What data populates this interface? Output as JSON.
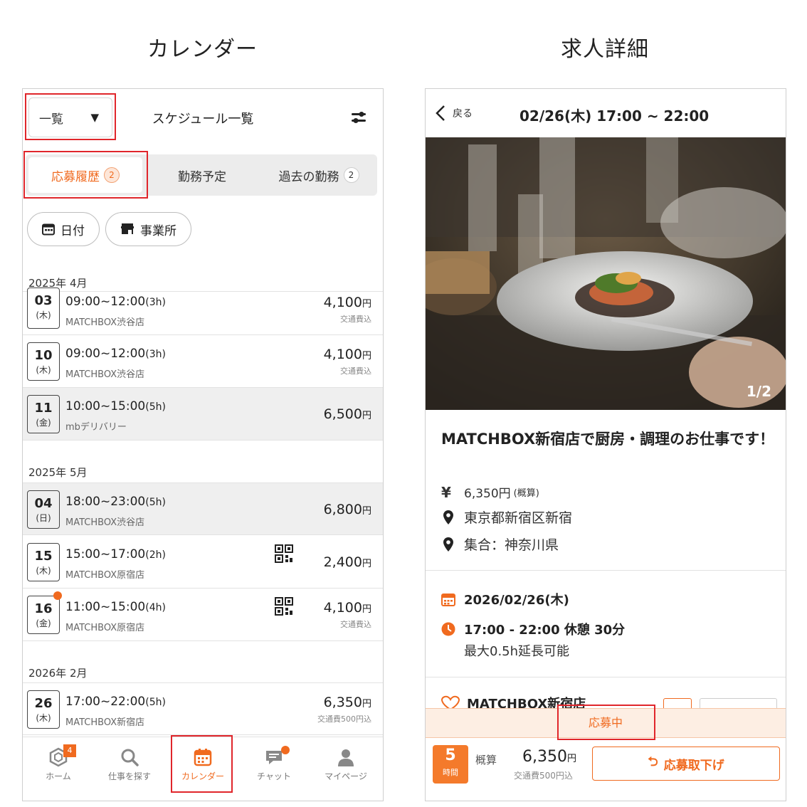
{
  "captions": {
    "left": "カレンダー",
    "right": "求人詳細"
  },
  "calendar": {
    "dropdown_value": "一覧",
    "title": "スケジュール一覧",
    "segments": [
      {
        "label": "応募履歴",
        "badge": "2"
      },
      {
        "label": "勤務予定"
      },
      {
        "label": "過去の勤務",
        "badge": "2"
      }
    ],
    "chips": [
      "日付",
      "事業所"
    ],
    "months": [
      "2025年 4月",
      "2025年 5月",
      "2026年 2月"
    ],
    "rows": [
      {
        "day": "03",
        "dow": "(木)",
        "time": "09:00~12:00",
        "dur": "(3h)",
        "place": "MATCHBOX渋谷店",
        "price": "4,100",
        "yen": "円",
        "note": "交通費込"
      },
      {
        "day": "10",
        "dow": "(木)",
        "time": "09:00~12:00",
        "dur": "(3h)",
        "place": "MATCHBOX渋谷店",
        "price": "4,100",
        "yen": "円",
        "note": "交通費込"
      },
      {
        "day": "11",
        "dow": "(金)",
        "time": "10:00~15:00",
        "dur": "(5h)",
        "place": "mbデリバリー",
        "price": "6,500",
        "yen": "円",
        "note": ""
      },
      {
        "day": "04",
        "dow": "(日)",
        "time": "18:00~23:00",
        "dur": "(5h)",
        "place": "MATCHBOX渋谷店",
        "price": "6,800",
        "yen": "円",
        "note": ""
      },
      {
        "day": "15",
        "dow": "(木)",
        "time": "15:00~17:00",
        "dur": "(2h)",
        "place": "MATCHBOX原宿店",
        "price": "2,400",
        "yen": "円",
        "note": ""
      },
      {
        "day": "16",
        "dow": "(金)",
        "time": "11:00~15:00",
        "dur": "(4h)",
        "place": "MATCHBOX原宿店",
        "price": "4,100",
        "yen": "円",
        "note": "交通費込"
      },
      {
        "day": "26",
        "dow": "(木)",
        "time": "17:00~22:00",
        "dur": "(5h)",
        "place": "MATCHBOX新宿店",
        "price": "6,350",
        "yen": "円",
        "note": "交通費500円込"
      }
    ],
    "tabs": [
      {
        "label": "ホーム",
        "badge": "4"
      },
      {
        "label": "仕事を探す"
      },
      {
        "label": "カレンダー"
      },
      {
        "label": "チャット"
      },
      {
        "label": "マイページ"
      }
    ],
    "accent": "#f06a1f"
  },
  "job": {
    "back_label": "戻る",
    "header_title": "02/26(木) 17:00 ~ 22:00",
    "photo_counter": "1/2",
    "title": "MATCHBOX新宿店で厨房・調理のお仕事です！",
    "wage": "6,350円",
    "wage_note": "(概算)",
    "address": "東京都新宿区新宿",
    "meeting": "集合：神奈川県",
    "date": "2026/02/26(木)",
    "time": "17:00 - 22:00 休憩 30分",
    "extension": "最大0.5h延長可能",
    "shop_peek": "MATCHBOX新宿店",
    "status": "応募中",
    "slots": "5",
    "slots_unit": "時間",
    "estimate_label": "概算",
    "estimate_price": "6,350",
    "estimate_yen": "円",
    "estimate_note": "交通費500円込",
    "cancel_label": "応募取下げ"
  }
}
